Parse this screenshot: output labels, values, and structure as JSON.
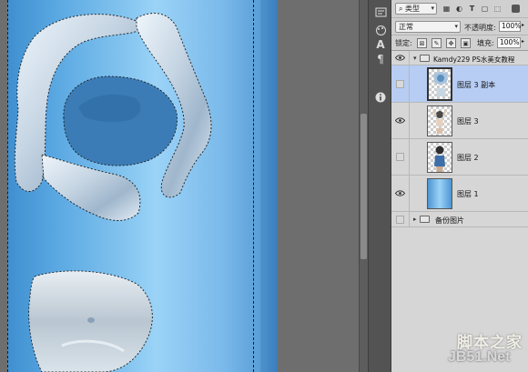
{
  "layers_panel": {
    "filter": {
      "label": "类型",
      "icon": "search-icon"
    },
    "blend_mode": "正常",
    "opacity": {
      "label": "不透明度:",
      "value": "100%"
    },
    "lock": {
      "label": "锁定:"
    },
    "fill": {
      "label": "填充:",
      "value": "100%"
    },
    "layers": [
      {
        "name": "Kamdy229  PS水美女教程",
        "kind": "group",
        "visible": true,
        "expanded": true
      },
      {
        "name": "图层 3 副本",
        "kind": "layer",
        "visible": false,
        "selected": true
      },
      {
        "name": "图层 3",
        "kind": "layer",
        "visible": true,
        "selected": false
      },
      {
        "name": "图层 2",
        "kind": "layer",
        "visible": false,
        "selected": false
      },
      {
        "name": "图层 1",
        "kind": "layer",
        "visible": true,
        "selected": false
      },
      {
        "name": "备份图片",
        "kind": "group",
        "visible": false,
        "expanded": false
      }
    ]
  },
  "tool_strip": [
    "history-icon",
    "palette-icon",
    "character-icon",
    "paragraph-icon",
    "info-icon"
  ],
  "watermark": {
    "line1": "脚本之家",
    "line2": "JB51.Net"
  },
  "colors": {
    "accent_selected": "#b7cdf3",
    "canvas_blue": "#7ec0ee"
  }
}
